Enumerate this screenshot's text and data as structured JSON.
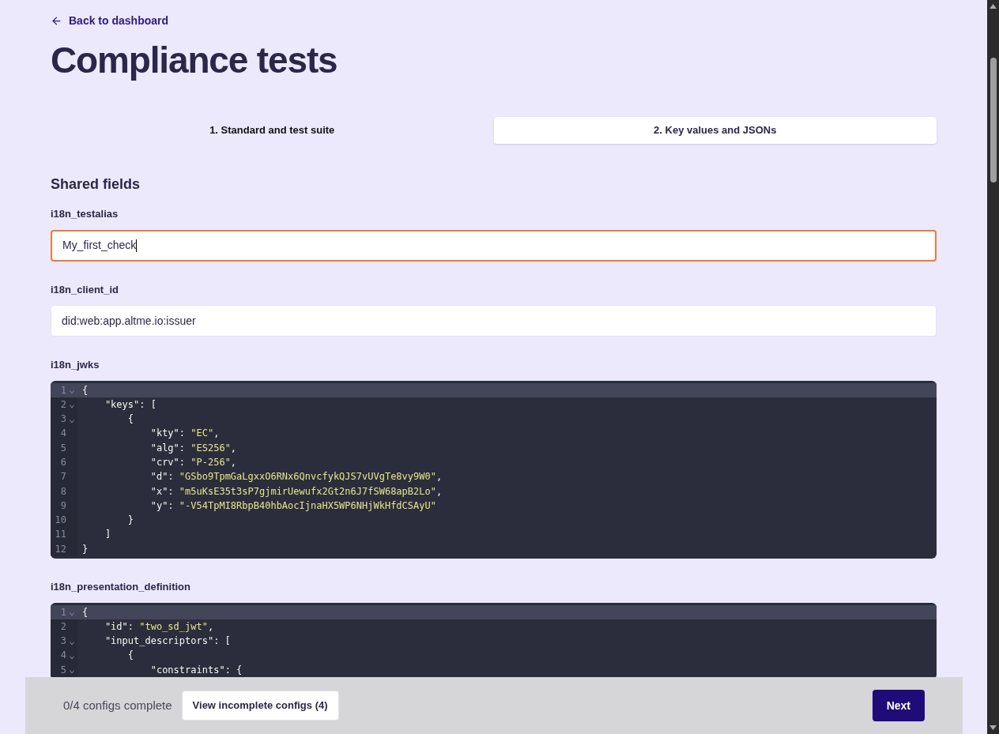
{
  "back_link": {
    "label": "Back to dashboard"
  },
  "title": "Compliance tests",
  "tabs": [
    {
      "label": "1. Standard and test suite",
      "selected": false
    },
    {
      "label": "2. Key values and JSONs",
      "selected": true
    }
  ],
  "section_title": "Shared fields",
  "fields": [
    {
      "kind": "text",
      "label": "i18n_testalias",
      "value": "My_first_check",
      "focused": true
    },
    {
      "kind": "text",
      "label": "i18n_client_id",
      "value": "did:web:app.altme.io:issuer",
      "focused": false
    },
    {
      "kind": "code",
      "label": "i18n_jwks",
      "lines": [
        {
          "number": "1",
          "fold": true,
          "active": true,
          "parts": [
            {
              "kind": "punct",
              "text": "{"
            }
          ]
        },
        {
          "number": "2",
          "fold": true,
          "active": false,
          "parts": [
            {
              "kind": "key",
              "text": "    \"keys\""
            },
            {
              "kind": "punct",
              "text": ": ["
            }
          ]
        },
        {
          "number": "3",
          "fold": true,
          "active": false,
          "parts": [
            {
              "kind": "punct",
              "text": "        {"
            }
          ]
        },
        {
          "number": "4",
          "fold": false,
          "active": false,
          "parts": [
            {
              "kind": "key",
              "text": "            \"kty\""
            },
            {
              "kind": "punct",
              "text": ": "
            },
            {
              "kind": "string",
              "text": "\"EC\""
            },
            {
              "kind": "punct",
              "text": ","
            }
          ]
        },
        {
          "number": "5",
          "fold": false,
          "active": false,
          "parts": [
            {
              "kind": "key",
              "text": "            \"alg\""
            },
            {
              "kind": "punct",
              "text": ": "
            },
            {
              "kind": "string",
              "text": "\"ES256\""
            },
            {
              "kind": "punct",
              "text": ","
            }
          ]
        },
        {
          "number": "6",
          "fold": false,
          "active": false,
          "parts": [
            {
              "kind": "key",
              "text": "            \"crv\""
            },
            {
              "kind": "punct",
              "text": ": "
            },
            {
              "kind": "string",
              "text": "\"P-256\""
            },
            {
              "kind": "punct",
              "text": ","
            }
          ]
        },
        {
          "number": "7",
          "fold": false,
          "active": false,
          "parts": [
            {
              "kind": "key",
              "text": "            \"d\""
            },
            {
              "kind": "punct",
              "text": ": "
            },
            {
              "kind": "string",
              "text": "\"GSbo9TpmGaLgxxO6RNx6QnvcfykQJS7vUVgTe8vy9W0\""
            },
            {
              "kind": "punct",
              "text": ","
            }
          ]
        },
        {
          "number": "8",
          "fold": false,
          "active": false,
          "parts": [
            {
              "kind": "key",
              "text": "            \"x\""
            },
            {
              "kind": "punct",
              "text": ": "
            },
            {
              "kind": "string",
              "text": "\"m5uKsE35t3sP7gjmirUewufx2Gt2n6J7fSW68apB2Lo\""
            },
            {
              "kind": "punct",
              "text": ","
            }
          ]
        },
        {
          "number": "9",
          "fold": false,
          "active": false,
          "parts": [
            {
              "kind": "key",
              "text": "            \"y\""
            },
            {
              "kind": "punct",
              "text": ": "
            },
            {
              "kind": "string",
              "text": "\"-V54TpMI8RbpB40hbAocIjnaHX5WP6NHjWkHfdCSAyU\""
            }
          ]
        },
        {
          "number": "10",
          "fold": false,
          "active": false,
          "parts": [
            {
              "kind": "punct",
              "text": "        }"
            }
          ]
        },
        {
          "number": "11",
          "fold": false,
          "active": false,
          "parts": [
            {
              "kind": "punct",
              "text": "    ]"
            }
          ]
        },
        {
          "number": "12",
          "fold": false,
          "active": false,
          "parts": [
            {
              "kind": "punct",
              "text": "}"
            }
          ]
        }
      ]
    },
    {
      "kind": "code",
      "label": "i18n_presentation_definition",
      "lines": [
        {
          "number": "1",
          "fold": true,
          "active": true,
          "parts": [
            {
              "kind": "punct",
              "text": "{"
            }
          ]
        },
        {
          "number": "2",
          "fold": false,
          "active": false,
          "parts": [
            {
              "kind": "key",
              "text": "    \"id\""
            },
            {
              "kind": "punct",
              "text": ": "
            },
            {
              "kind": "string",
              "text": "\"two_sd_jwt\""
            },
            {
              "kind": "punct",
              "text": ","
            }
          ]
        },
        {
          "number": "3",
          "fold": true,
          "active": false,
          "parts": [
            {
              "kind": "key",
              "text": "    \"input_descriptors\""
            },
            {
              "kind": "punct",
              "text": ": ["
            }
          ]
        },
        {
          "number": "4",
          "fold": true,
          "active": false,
          "parts": [
            {
              "kind": "punct",
              "text": "        {"
            }
          ]
        },
        {
          "number": "5",
          "fold": true,
          "active": false,
          "parts": [
            {
              "kind": "key",
              "text": "            \"constraints\""
            },
            {
              "kind": "punct",
              "text": ": {"
            }
          ]
        }
      ]
    }
  ],
  "footer": {
    "status": "0/4 configs complete",
    "incomplete_button": "View incomplete configs (4)",
    "next_button": "Next"
  }
}
